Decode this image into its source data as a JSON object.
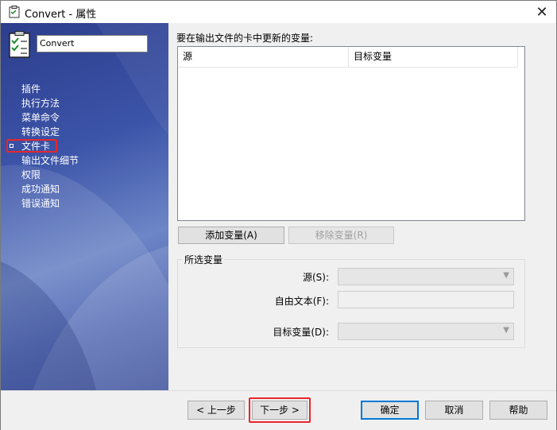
{
  "window": {
    "title": "Convert - 属性",
    "close_glyph": "✕"
  },
  "sidebar": {
    "name_value": "Convert",
    "items": [
      {
        "label": "插件"
      },
      {
        "label": "执行方法"
      },
      {
        "label": "菜单命令"
      },
      {
        "label": "转换设定"
      },
      {
        "label": "文件卡",
        "active": true
      },
      {
        "label": "输出文件细节"
      },
      {
        "label": "权限"
      },
      {
        "label": "成功通知"
      },
      {
        "label": "错误通知"
      }
    ]
  },
  "main": {
    "section_label": "要在输出文件的卡中更新的变量:",
    "table": {
      "columns": [
        "源",
        "目标变量"
      ],
      "rows": []
    },
    "add_button": "添加变量(A)",
    "remove_button": "移除变量(R)",
    "selected_group": {
      "title": "所选变量",
      "source_label": "源(S):",
      "source_value": "",
      "freetext_label": "自由文本(F):",
      "freetext_value": "",
      "target_label": "目标变量(D):",
      "target_value": ""
    }
  },
  "footer": {
    "prev_button": "< 上一步",
    "next_button": "下一步 >",
    "ok_button": "确定",
    "cancel_button": "取消",
    "help_button": "帮助"
  },
  "colors": {
    "highlight": "#e8262b",
    "default_button_border": "#0078d7"
  }
}
